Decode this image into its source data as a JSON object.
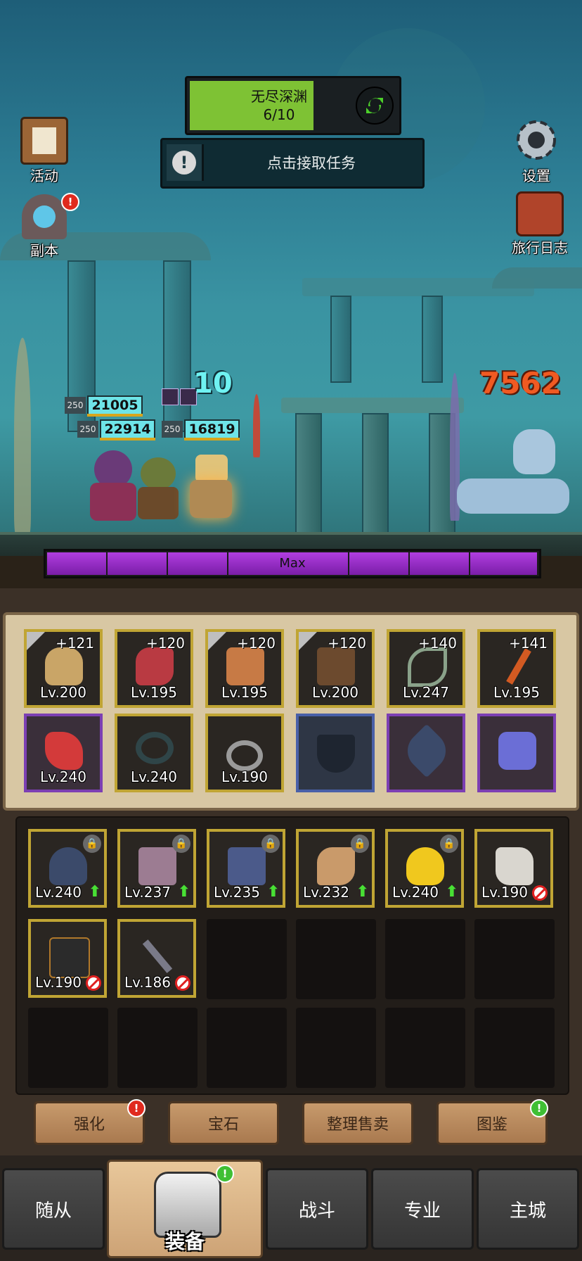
{
  "quest": {
    "title": "无尽深渊",
    "progress": "6/10",
    "progress_fraction": 0.6
  },
  "task": {
    "label": "点击接取任务"
  },
  "side_buttons": {
    "activity": "活动",
    "dungeon": "副本",
    "settings": "设置",
    "journal": "旅行日志"
  },
  "battle": {
    "damage_ally": "10",
    "damage_enemy": "7562",
    "heroes": [
      {
        "level": "250",
        "hp": "21005"
      },
      {
        "level": "250",
        "hp": "22914"
      },
      {
        "level": "250",
        "hp": "16819"
      }
    ],
    "rage_label": "Max"
  },
  "equipped": [
    {
      "plus": "+121",
      "level": "Lv.200",
      "item": "skull-helmet"
    },
    {
      "plus": "+120",
      "level": "Lv.195",
      "item": "gauntlet"
    },
    {
      "plus": "+120",
      "level": "Lv.195",
      "item": "chest-armor"
    },
    {
      "plus": "+120",
      "level": "Lv.200",
      "item": "leather-armor"
    },
    {
      "plus": "+140",
      "level": "Lv.247",
      "item": "bone-bow"
    },
    {
      "plus": "+141",
      "level": "Lv.195",
      "item": "curved-dagger"
    },
    {
      "plus": "",
      "level": "Lv.240",
      "item": "red-glove"
    },
    {
      "plus": "",
      "level": "Lv.240",
      "item": "dark-ring"
    },
    {
      "plus": "",
      "level": "Lv.190",
      "item": "blue-gem-ring"
    },
    {
      "plus": "",
      "level": "",
      "item": "empty-shield-slot"
    },
    {
      "plus": "",
      "level": "",
      "item": "arrowhead"
    },
    {
      "plus": "",
      "level": "",
      "item": "target-emblem"
    }
  ],
  "bag": [
    {
      "level": "Lv.240",
      "status": "upgrade",
      "item": "horned-helmet"
    },
    {
      "level": "Lv.237",
      "status": "upgrade",
      "item": "bracer"
    },
    {
      "level": "Lv.235",
      "status": "upgrade",
      "item": "plate-armor"
    },
    {
      "level": "Lv.232",
      "status": "upgrade",
      "item": "claw-arm"
    },
    {
      "level": "Lv.240",
      "status": "upgrade",
      "item": "golden-bag"
    },
    {
      "level": "Lv.190",
      "status": "banned",
      "item": "silver-gauntlet"
    },
    {
      "level": "Lv.190",
      "status": "banned",
      "item": "dark-chest"
    },
    {
      "level": "Lv.186",
      "status": "banned",
      "item": "mace"
    }
  ],
  "actions": {
    "enhance": "强化",
    "gem": "宝石",
    "sort_sell": "整理售卖",
    "codex": "图鉴"
  },
  "tabs": {
    "followers": "随从",
    "equipment": "装备",
    "battle": "战斗",
    "profession": "专业",
    "main_city": "主城"
  },
  "colors": {
    "accent_green": "#7ec234",
    "rage_purple": "#9b34c8",
    "gold_border": "#c0a534",
    "epic_purple": "#7c3fb3"
  }
}
